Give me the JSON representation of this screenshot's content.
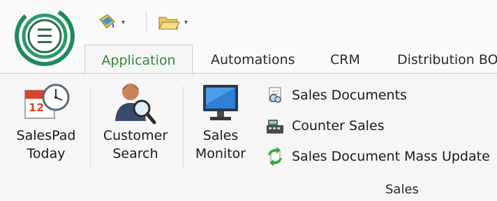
{
  "app": {
    "menu_icon": "hamburger-menu-icon"
  },
  "quick_access": [
    {
      "icon": "paint-bucket-icon",
      "arrow": "▾"
    },
    {
      "icon": "folder-open-icon",
      "arrow": "▾"
    }
  ],
  "tabs": [
    {
      "label": "Application",
      "active": true
    },
    {
      "label": "Automations",
      "active": false
    },
    {
      "label": "CRM",
      "active": false
    },
    {
      "label": "Distribution BO",
      "active": false
    }
  ],
  "ribbon": {
    "large_buttons": [
      {
        "label": "SalesPad\nToday",
        "icon": "calendar-clock-icon"
      },
      {
        "label": "Customer\nSearch",
        "icon": "person-magnifier-icon"
      },
      {
        "label": "Sales\nMonitor",
        "icon": "monitor-icon"
      }
    ],
    "small_buttons": [
      {
        "label": "Sales Documents",
        "icon": "sales-documents-icon"
      },
      {
        "label": "Counter Sales",
        "icon": "cash-register-icon"
      },
      {
        "label": "Sales Document Mass Update",
        "icon": "refresh-arrows-icon"
      }
    ],
    "group_label": "Sales"
  },
  "colors": {
    "accent_green": "#2e8b3a",
    "background": "#f6f6f6"
  }
}
